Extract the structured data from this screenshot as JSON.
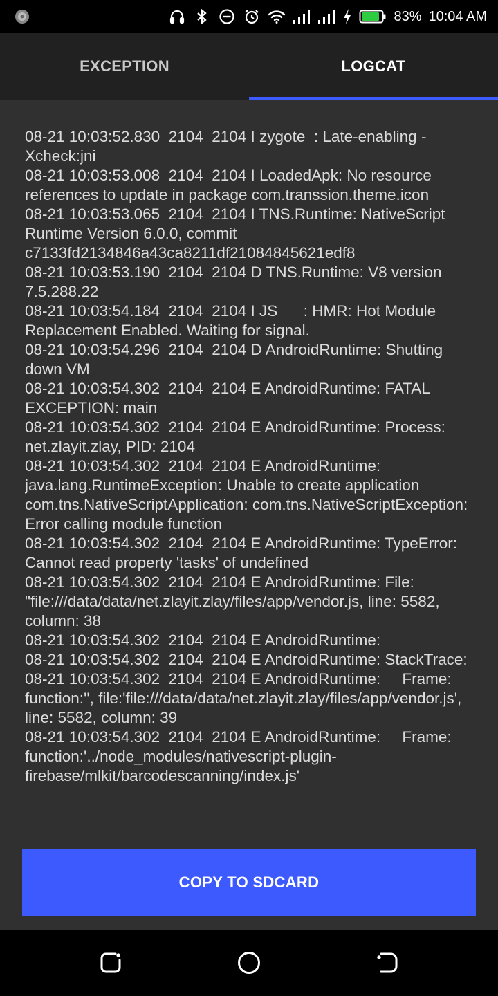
{
  "status_bar": {
    "battery_percent": "83%",
    "time": "10:04 AM",
    "icons": [
      "app-notification-icon",
      "headphones-icon",
      "bluetooth-icon",
      "do-not-disturb-icon",
      "alarm-icon",
      "wifi-icon",
      "signal-icon",
      "signal-icon-2",
      "charging-icon",
      "battery-icon"
    ]
  },
  "tabs": [
    {
      "label": "EXCEPTION",
      "selected": false
    },
    {
      "label": "LOGCAT",
      "selected": true
    }
  ],
  "colors": {
    "accent": "#3d5afe",
    "tab_bar": "#212121",
    "content_bg": "#303030"
  },
  "logcat": {
    "text": "08-21 10:03:52.830  2104  2104 I zygote  : Late-enabling -Xcheck:jni\n08-21 10:03:53.008  2104  2104 I LoadedApk: No resource references to update in package com.transsion.theme.icon\n08-21 10:03:53.065  2104  2104 I TNS.Runtime: NativeScript Runtime Version 6.0.0, commit c7133fd2134846a43ca8211df21084845621edf8\n08-21 10:03:53.190  2104  2104 D TNS.Runtime: V8 version 7.5.288.22\n08-21 10:03:54.184  2104  2104 I JS      : HMR: Hot Module Replacement Enabled. Waiting for signal.\n08-21 10:03:54.296  2104  2104 D AndroidRuntime: Shutting down VM\n08-21 10:03:54.302  2104  2104 E AndroidRuntime: FATAL EXCEPTION: main\n08-21 10:03:54.302  2104  2104 E AndroidRuntime: Process: net.zlayit.zlay, PID: 2104\n08-21 10:03:54.302  2104  2104 E AndroidRuntime: java.lang.RuntimeException: Unable to create application com.tns.NativeScriptApplication: com.tns.NativeScriptException: Error calling module function\n08-21 10:03:54.302  2104  2104 E AndroidRuntime: TypeError: Cannot read property 'tasks' of undefined\n08-21 10:03:54.302  2104  2104 E AndroidRuntime: File: \"file:///data/data/net.zlayit.zlay/files/app/vendor.js, line: 5582, column: 38\n08-21 10:03:54.302  2104  2104 E AndroidRuntime:\n08-21 10:03:54.302  2104  2104 E AndroidRuntime: StackTrace:\n08-21 10:03:54.302  2104  2104 E AndroidRuntime:     Frame: function:'', file:'file:///data/data/net.zlayit.zlay/files/app/vendor.js', line: 5582, column: 39\n08-21 10:03:54.302  2104  2104 E AndroidRuntime:     Frame: function:'../node_modules/nativescript-plugin-firebase/mlkit/barcodescanning/index.js'"
  },
  "copy_button": {
    "label": "COPY TO SDCARD"
  },
  "nav": {
    "icons": [
      "recents-icon",
      "home-icon",
      "back-icon"
    ]
  }
}
